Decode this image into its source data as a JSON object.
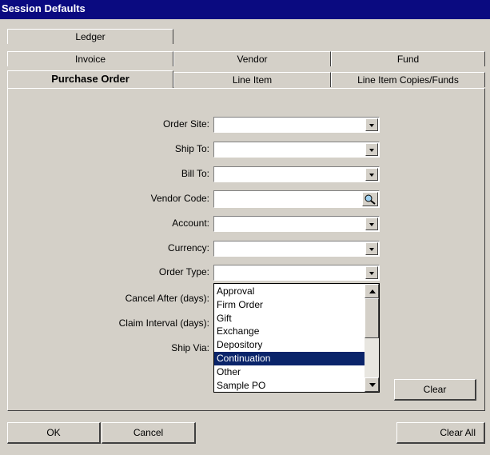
{
  "window": {
    "title": "Session Defaults"
  },
  "tabs": {
    "ledger": "Ledger",
    "invoice": "Invoice",
    "vendor": "Vendor",
    "fund": "Fund",
    "purchase_order": "Purchase Order",
    "line_item": "Line Item",
    "line_item_copies_funds": "Line Item Copies/Funds"
  },
  "form": {
    "order_site": {
      "label": "Order Site:",
      "value": ""
    },
    "ship_to": {
      "label": "Ship To:",
      "value": ""
    },
    "bill_to": {
      "label": "Bill To:",
      "value": ""
    },
    "vendor_code": {
      "label": "Vendor Code:",
      "value": ""
    },
    "account": {
      "label": "Account:",
      "value": ""
    },
    "currency": {
      "label": "Currency:",
      "value": ""
    },
    "order_type": {
      "label": "Order Type:",
      "value": ""
    },
    "cancel_after": {
      "label": "Cancel After (days):"
    },
    "claim_interval": {
      "label": "Claim Interval (days):"
    },
    "ship_via": {
      "label": "Ship Via:"
    }
  },
  "order_type_options": [
    "Approval",
    "Firm Order",
    "Gift",
    "Exchange",
    "Depository",
    "Continuation",
    "Other",
    "Sample PO"
  ],
  "order_type_highlighted": "Continuation",
  "buttons": {
    "clear": "Clear",
    "ok": "OK",
    "cancel": "Cancel",
    "clear_all": "Clear All"
  },
  "colors": {
    "title_bar": "#0a0a80",
    "selection": "#0a246a",
    "face": "#d4d0c8"
  },
  "icons": {
    "vendor_lookup": "magnifier-icon"
  }
}
